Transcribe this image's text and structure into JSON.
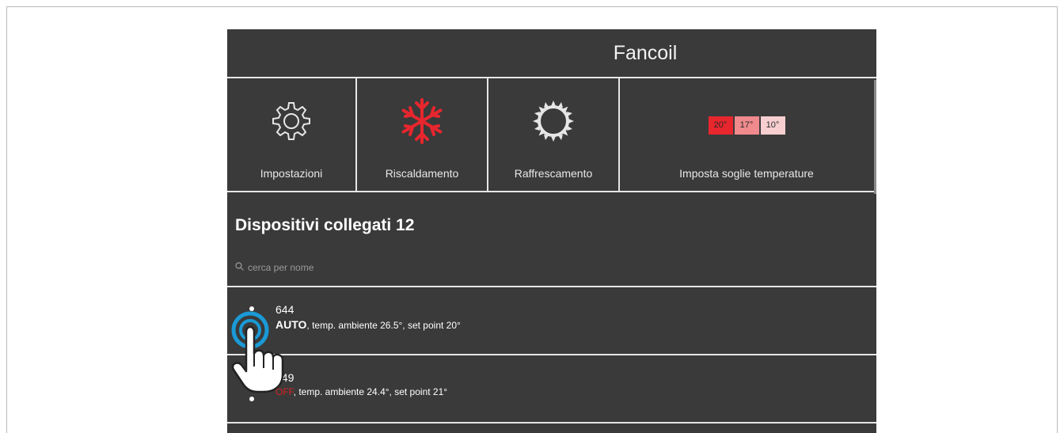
{
  "app": {
    "title": "Fancoil"
  },
  "tiles": [
    {
      "label": "Impostazioni",
      "icon": "gear-icon"
    },
    {
      "label": "Riscaldamento",
      "icon": "snowflake-icon"
    },
    {
      "label": "Raffrescamento",
      "icon": "sun-icon"
    },
    {
      "label": "Imposta soglie temperature",
      "icon": "temperature-thresholds-icon",
      "thresholds": [
        {
          "value": "20°",
          "color": "#e8262e"
        },
        {
          "value": "17°",
          "color": "#f08a8d"
        },
        {
          "value": "10°",
          "color": "#f8cfd0"
        }
      ]
    }
  ],
  "devices_section": {
    "title": "Dispositivi collegati 12"
  },
  "search": {
    "placeholder": "cerca per nome",
    "value": ""
  },
  "devices": [
    {
      "name": "644",
      "mode": "AUTO",
      "details": ", temp. ambiente 26.5°, set point 20°"
    },
    {
      "name": "649",
      "mode": "OFF",
      "details": ", temp. ambiente 24.4°, set point 21°"
    }
  ],
  "colors": {
    "background": "#3a3a3a",
    "accent_red": "#e8262e",
    "tap_ring": "#1a9ad6"
  }
}
